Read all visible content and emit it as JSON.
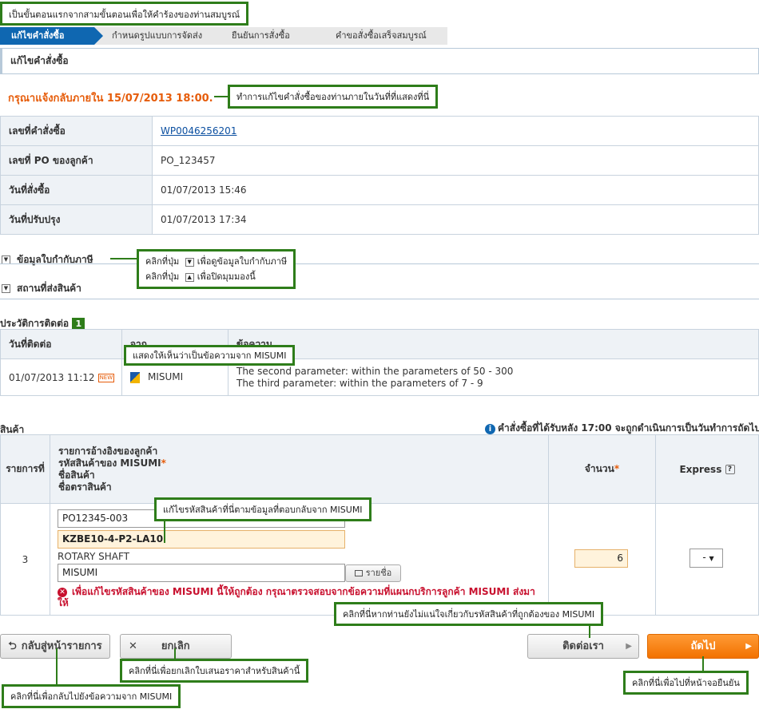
{
  "callouts": {
    "step1": "เป็นขั้นตอนแรกจากสามขั้นตอนเพื่อให้คำร้องของท่านสมบูรณ์",
    "deadline": "ทำการแก้ไขคำสั่งซื้อของท่านภายในวันที่ที่แสดงที่นี่",
    "toggle_l1_pre": "คลิกที่ปุ่ม",
    "toggle_l1_post": "เพื่อดูข้อมูลใบกำกับภาษี",
    "toggle_l2_pre": "คลิกที่ปุ่ม",
    "toggle_l2_post": "เพื่อปิดมุมมองนี้",
    "from_misumi": "แสดงให้เห็นว่าเป็นข้อความจาก MISUMI",
    "fix_code": "แก้ไขรหัสสินค้าที่นี่ตามข้อมูลที่ตอบกลับจาก MISUMI",
    "contact": "คลิกที่นี่หากท่านยังไม่แน่ใจเกี่ยวกับรหัสสินค้าที่ถูกต้องของ MISUMI",
    "cancel": "คลิกที่นี่เพื่อยกเลิกใบเสนอราคาสำหรับสินค้านี้",
    "back": "คลิกที่นี่เพื่อกลับไปยังข้อความจาก MISUMI",
    "next": "คลิกที่นี่เพื่อไปที่หน้าจอยืนยัน"
  },
  "steps": [
    "แก้ไขคำสั่งซื้อ",
    "กำหนดรูปแบบการจัดส่ง",
    "ยืนยันการสั่งซื้อ",
    "คำขอสั่งซื้อเสร็จสมบูรณ์"
  ],
  "section_title": "แก้ไขคำสั่งซื้อ",
  "deadline_text": "กรุณาแจ้งกลับภายใน 15/07/2013 18:00.",
  "order_info": [
    {
      "label": "เลขที่คำสั่งซื้อ",
      "value": "WP0046256201"
    },
    {
      "label": "เลขที่ PO ของลูกค้า",
      "value": "PO_123457"
    },
    {
      "label": "วันที่สั่งซื้อ",
      "value": "01/07/2013 15:46"
    },
    {
      "label": "วันที่ปรับปรุง",
      "value": "01/07/2013 17:34"
    }
  ],
  "toggles": {
    "invoice": "ข้อมูลใบกำกับภาษี",
    "shipping": "สถานที่ส่งสินค้า"
  },
  "history": {
    "title": "ประวัติการติดต่อ",
    "count": "1",
    "headers": [
      "วันที่ติดต่อ",
      "จาก",
      "ข้อความ"
    ],
    "row": {
      "date": "01/07/2013 11:12",
      "new_badge": "NEW",
      "from": "MISUMI",
      "msg1": "The second parameter: within the parameters of 50 - 300",
      "msg2": "The third parameter: within the parameters of 7 - 9"
    }
  },
  "product": {
    "title": "สินค้า",
    "notice": "คำสั่งซื้อที่ได้รับหลัง 17:00 จะถูกดำเนินการเป็นวันทำการถัดไป",
    "headers": {
      "item": "รายการที่",
      "ref1": "รายการอ้างอิงของลูกค้า",
      "ref2": "รหัสสินค้าของ MISUMI",
      "ref3": "ชื่อสินค้า",
      "ref4": "ชื่อตราสินค้า",
      "qty": "จำนวน",
      "express": "Express",
      "req": "*",
      "help": "?"
    },
    "row": {
      "num": "3",
      "po": "PO12345-003",
      "code": "KZBE10-4-P2-LA10",
      "name": "ROTARY SHAFT",
      "brand": "MISUMI",
      "brand_btn": "รายชื่อ",
      "error": "เพื่อแก้ไขรหัสสินค้าของ MISUMI นี้ให้ถูกต้อง กรุณาตรวจสอบจากข้อความที่แผนกบริการลูกค้า MISUMI ส่งมาให้",
      "qty": "6",
      "express": "-"
    }
  },
  "buttons": {
    "back": "กลับสู่หน้ารายการ",
    "cancel": "ยกเลิก",
    "contact": "ติดต่อเรา",
    "next": "ถัดไป"
  }
}
